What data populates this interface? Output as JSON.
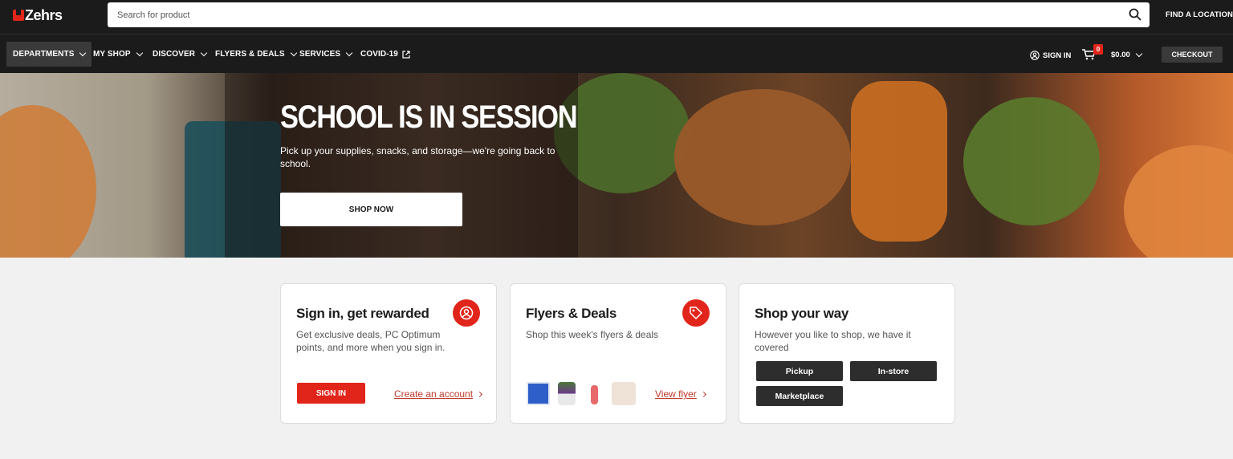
{
  "header": {
    "brand": "Zehrs",
    "search_placeholder": "Search for product",
    "find_location": "FIND A LOCATION"
  },
  "nav": {
    "items": [
      {
        "label": "DEPARTMENTS"
      },
      {
        "label": "MY SHOP"
      },
      {
        "label": "DISCOVER"
      },
      {
        "label": "FLYERS & DEALS"
      },
      {
        "label": "SERVICES"
      },
      {
        "label": "COVID-19"
      }
    ],
    "sign_in": "SIGN IN",
    "cart_count": "0",
    "cart_total": "$0.00",
    "checkout": "CHECKOUT"
  },
  "hero": {
    "title": "SCHOOL IS IN SESSION",
    "subtitle": "Pick up your supplies, snacks, and storage—we're going back to school.",
    "button": "SHOP NOW"
  },
  "cards": {
    "signin": {
      "title": "Sign in, get rewarded",
      "body": "Get exclusive deals, PC Optimum points, and more when you sign in.",
      "button": "SIGN IN",
      "link": "Create an account"
    },
    "flyers": {
      "title": "Flyers & Deals",
      "body": "Shop this week's flyers & deals",
      "link": "View flyer"
    },
    "shop": {
      "title": "Shop your way",
      "body": "However you like to shop, we have it covered",
      "options": [
        "Pickup",
        "In-store",
        "Marketplace"
      ]
    }
  },
  "colors": {
    "brand_red": "#e1251b",
    "dark": "#1b1b1b"
  }
}
